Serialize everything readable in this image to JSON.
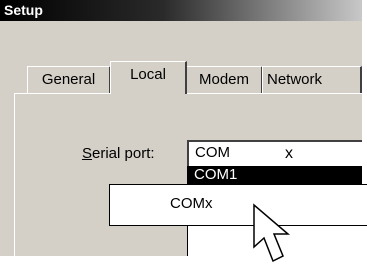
{
  "window": {
    "title": "Setup"
  },
  "tabs": [
    {
      "label": "General",
      "selected": false
    },
    {
      "label": "Local",
      "selected": true
    },
    {
      "label": "Modem",
      "selected": false
    },
    {
      "label": "Network",
      "selected": false
    }
  ],
  "serial_port": {
    "label_mnemonic": "S",
    "label_rest": "erial port:",
    "value": "COM",
    "value_suffix": "x",
    "options": [
      "COM1"
    ]
  },
  "callout": {
    "text": "COMx"
  },
  "cursor": {
    "icon": "arrow-pointer-icon"
  }
}
